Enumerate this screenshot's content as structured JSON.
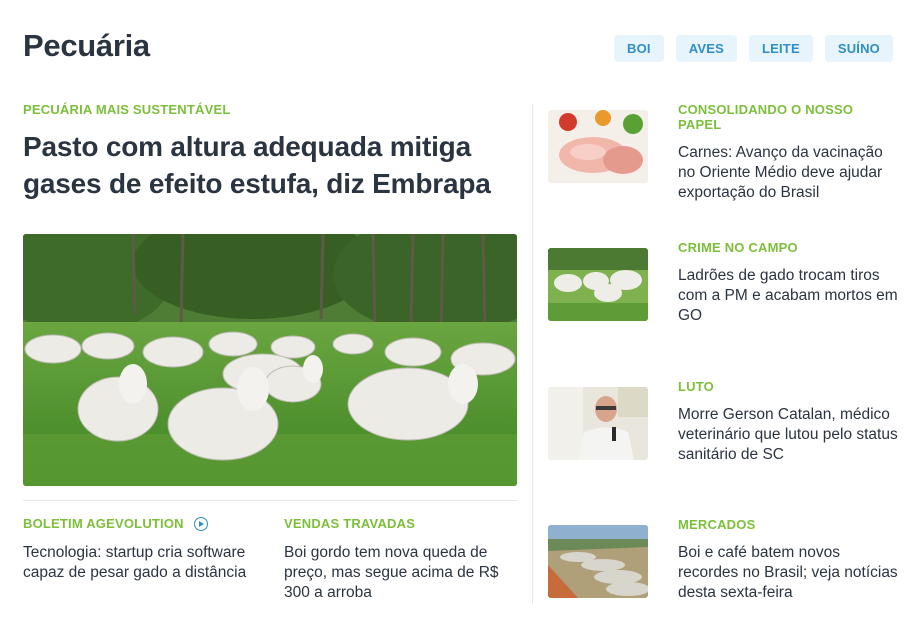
{
  "section": {
    "title": "Pecuária"
  },
  "tags": [
    "BOI",
    "AVES",
    "LEITE",
    "SUÍNO"
  ],
  "main_story": {
    "kicker": "PECUÁRIA MAIS SUSTENTÁVEL",
    "headline": "Pasto com altura adequada mitiga gases de efeito estufa, diz Embrapa"
  },
  "sub_stories": [
    {
      "kicker": "BOLETIM AGEVOLUTION",
      "title": "Tecnologia: startup cria software capaz de pesar gado a distância",
      "icon": "play-circle-icon"
    },
    {
      "kicker": "VENDAS TRAVADAS",
      "title": "Boi gordo tem nova queda de preço, mas segue acima de R$ 300 a arroba"
    }
  ],
  "side_stories": [
    {
      "kicker": "CONSOLIDANDO O NOSSO PAPEL",
      "title": "Carnes: Avanço da vacinação no Oriente Médio deve ajudar exportação do Brasil"
    },
    {
      "kicker": "CRIME NO CAMPO",
      "title": "Ladrões de gado trocam tiros com a PM e acabam mortos em GO"
    },
    {
      "kicker": "LUTO",
      "title": "Morre Gerson Catalan, médico veterinário que lutou pelo status sanitário de SC"
    },
    {
      "kicker": "MERCADOS",
      "title": "Boi e café batem novos recordes no Brasil; veja notícias desta sexta-feira"
    }
  ],
  "colors": {
    "kicker": "#7cbf3a",
    "tag_bg": "#e8f4fb",
    "tag_text": "#2f8fc6",
    "headline": "#2b3441"
  }
}
